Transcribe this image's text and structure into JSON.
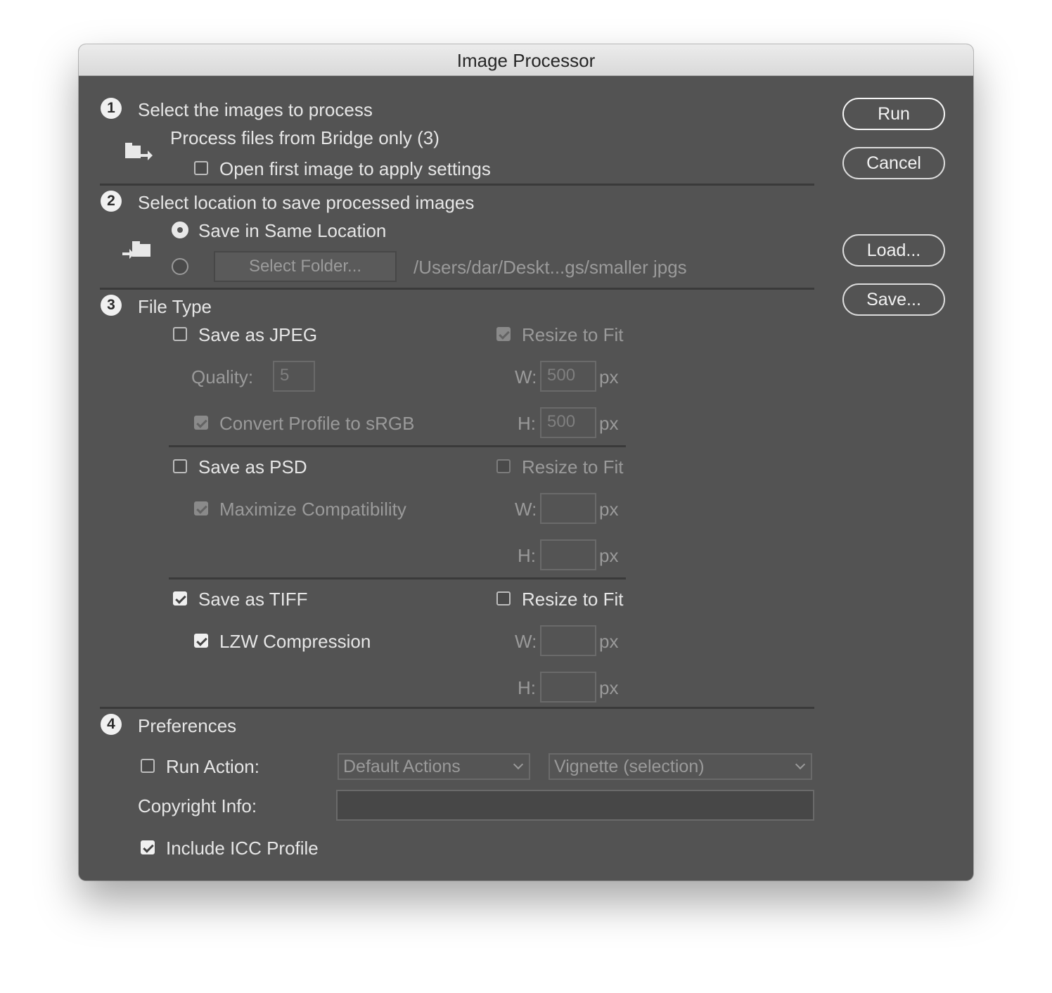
{
  "window": {
    "title": "Image Processor"
  },
  "buttons": {
    "run": "Run",
    "cancel": "Cancel",
    "load": "Load...",
    "save": "Save..."
  },
  "step1": {
    "number": "1",
    "heading": "Select the images to process",
    "source_text": "Process files from Bridge only (3)",
    "open_first_label": "Open first image to apply settings",
    "open_first_checked": false,
    "icon": "bridge-files-icon"
  },
  "step2": {
    "number": "2",
    "heading": "Select location to save processed images",
    "same_location_label": "Save in Same Location",
    "same_location_selected": true,
    "select_folder_label": "Select Folder...",
    "folder_path": "/Users/dar/Deskt...gs/smaller jpgs",
    "icon": "save-folder-icon"
  },
  "step3": {
    "number": "3",
    "heading": "File Type",
    "jpeg": {
      "label": "Save as JPEG",
      "checked": false,
      "resize_label": "Resize to Fit",
      "resize_checked": true,
      "quality_label": "Quality:",
      "quality_value": "5",
      "convert_label": "Convert Profile to sRGB",
      "convert_checked": true,
      "w_label": "W:",
      "w_value": "500",
      "h_label": "H:",
      "h_value": "500",
      "unit": "px"
    },
    "psd": {
      "label": "Save as PSD",
      "checked": false,
      "resize_label": "Resize to Fit",
      "resize_checked": false,
      "maximize_label": "Maximize Compatibility",
      "maximize_checked": true,
      "w_label": "W:",
      "w_value": "",
      "h_label": "H:",
      "h_value": "",
      "unit": "px"
    },
    "tiff": {
      "label": "Save as TIFF",
      "checked": true,
      "resize_label": "Resize to Fit",
      "resize_checked": false,
      "lzw_label": "LZW Compression",
      "lzw_checked": true,
      "w_label": "W:",
      "w_value": "",
      "h_label": "H:",
      "h_value": "",
      "unit": "px"
    }
  },
  "step4": {
    "number": "4",
    "heading": "Preferences",
    "run_action_label": "Run Action:",
    "run_action_checked": false,
    "action_set": "Default Actions",
    "action": "Vignette (selection)",
    "copyright_label": "Copyright Info:",
    "copyright_value": "",
    "icc_label": "Include ICC Profile",
    "icc_checked": true
  }
}
